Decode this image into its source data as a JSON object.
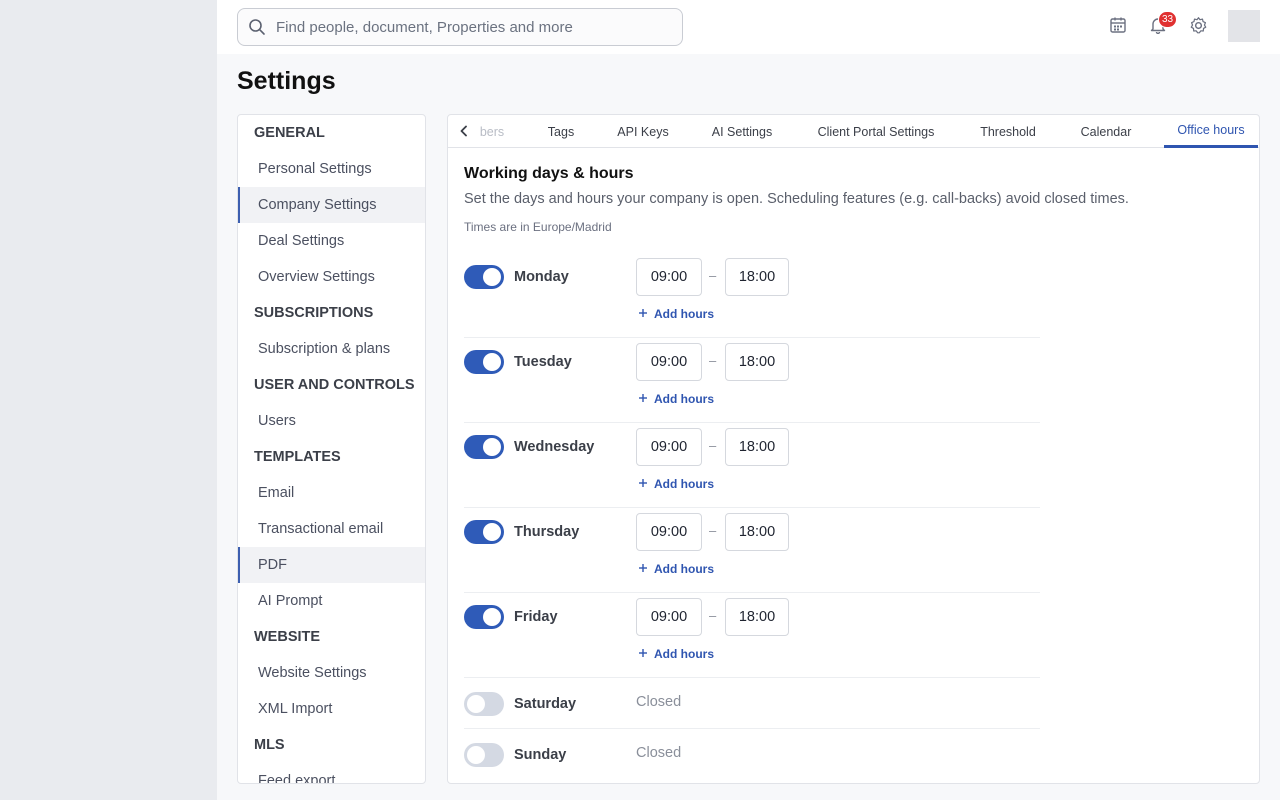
{
  "search": {
    "placeholder": "Find people, document, Properties and more"
  },
  "topbar": {
    "notifications_count": "33"
  },
  "page": {
    "title": "Settings"
  },
  "sidebar": {
    "items": [
      {
        "type": "heading",
        "label": "GENERAL"
      },
      {
        "type": "item",
        "label": "Personal Settings"
      },
      {
        "type": "item",
        "label": "Company Settings",
        "active": true
      },
      {
        "type": "item",
        "label": "Deal Settings"
      },
      {
        "type": "item",
        "label": "Overview Settings"
      },
      {
        "type": "heading",
        "label": "SUBSCRIPTIONS"
      },
      {
        "type": "item",
        "label": "Subscription & plans"
      },
      {
        "type": "heading",
        "label": "USER AND CONTROLS"
      },
      {
        "type": "item",
        "label": "Users"
      },
      {
        "type": "heading",
        "label": "TEMPLATES"
      },
      {
        "type": "item",
        "label": "Email"
      },
      {
        "type": "item",
        "label": "Transactional email"
      },
      {
        "type": "item",
        "label": "PDF",
        "active": true
      },
      {
        "type": "item",
        "label": "AI Prompt"
      },
      {
        "type": "heading",
        "label": "WEBSITE"
      },
      {
        "type": "item",
        "label": "Website Settings"
      },
      {
        "type": "item",
        "label": "XML Import"
      },
      {
        "type": "heading",
        "label": "MLS"
      },
      {
        "type": "item",
        "label": "Feed export"
      }
    ]
  },
  "tabs": [
    {
      "label": "bers",
      "faded": true
    },
    {
      "label": "Tags"
    },
    {
      "label": "API Keys"
    },
    {
      "label": "AI Settings"
    },
    {
      "label": "Client Portal Settings"
    },
    {
      "label": "Threshold"
    },
    {
      "label": "Calendar"
    },
    {
      "label": "Office hours",
      "active": true
    }
  ],
  "office_hours": {
    "title": "Working days & hours",
    "description": "Set the days and hours your company is open. Scheduling features (e.g. call-backs) avoid closed times.",
    "timezone_note": "Times are in Europe/Madrid",
    "add_hours_label": "Add hours",
    "closed_label": "Closed",
    "days": [
      {
        "name": "Monday",
        "enabled": true,
        "start": "09:00",
        "end": "18:00"
      },
      {
        "name": "Tuesday",
        "enabled": true,
        "start": "09:00",
        "end": "18:00"
      },
      {
        "name": "Wednesday",
        "enabled": true,
        "start": "09:00",
        "end": "18:00"
      },
      {
        "name": "Thursday",
        "enabled": true,
        "start": "09:00",
        "end": "18:00"
      },
      {
        "name": "Friday",
        "enabled": true,
        "start": "09:00",
        "end": "18:00"
      },
      {
        "name": "Saturday",
        "enabled": false
      },
      {
        "name": "Sunday",
        "enabled": false
      }
    ],
    "separator": "–"
  },
  "colors": {
    "accent": "#2f55b0",
    "toggle_on": "#2f5bb8",
    "toggle_off": "#d4d9e3",
    "badge": "#e03131"
  }
}
